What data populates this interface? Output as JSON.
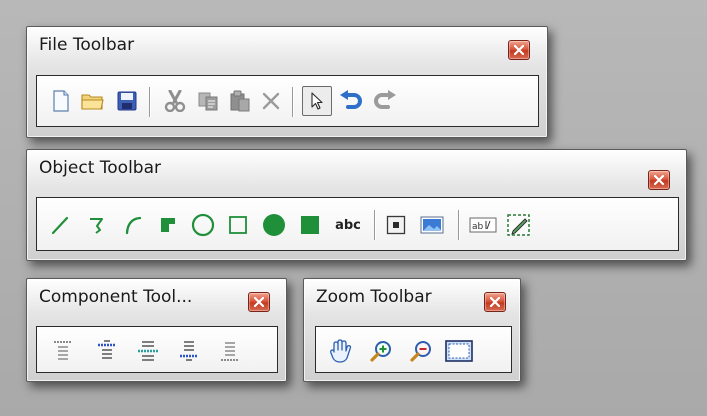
{
  "toolbars": {
    "file": {
      "title": "File Toolbar",
      "buttons": [
        "new-file",
        "open-folder",
        "save",
        "cut",
        "copy",
        "paste",
        "delete",
        "select-pointer",
        "undo",
        "redo"
      ]
    },
    "object": {
      "title": "Object Toolbar",
      "buttons": [
        "line",
        "polyline",
        "arc",
        "filled-corner",
        "ellipse",
        "rectangle",
        "filled-ellipse",
        "filled-rectangle",
        "text",
        "frame",
        "image",
        "text-field",
        "edit-box"
      ],
      "text_tool_label": "abc"
    },
    "component": {
      "title": "Component Tool...",
      "buttons": [
        "align-top",
        "align-center-top",
        "align-middle",
        "align-center-bottom",
        "align-bottom"
      ]
    },
    "zoom": {
      "title": "Zoom Toolbar",
      "buttons": [
        "pan-hand",
        "zoom-in",
        "zoom-out",
        "zoom-fit"
      ]
    }
  },
  "colors": {
    "close_button": "#d9573e",
    "shape_green": "#1f8f3a",
    "icon_blue": "#2d6fc9",
    "disabled_gray": "#9b9b9b"
  }
}
